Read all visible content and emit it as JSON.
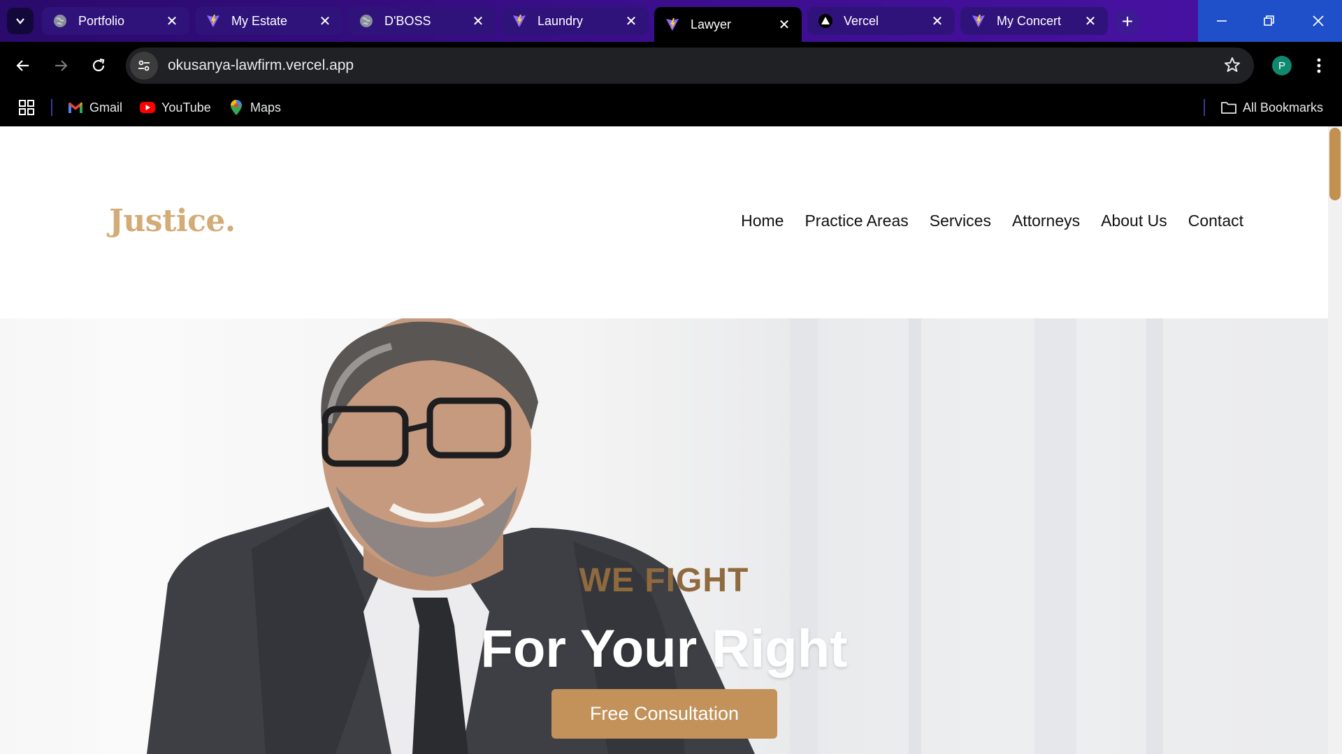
{
  "browser": {
    "tabs": [
      {
        "title": "Portfolio",
        "icon": "globe-icon"
      },
      {
        "title": "My Estate",
        "icon": "vite-icon"
      },
      {
        "title": "D'BOSS",
        "icon": "globe-icon"
      },
      {
        "title": "Laundry",
        "icon": "vite-icon"
      },
      {
        "title": "Lawyer",
        "icon": "vite-icon",
        "active": true
      },
      {
        "title": "Vercel",
        "icon": "vercel-icon"
      },
      {
        "title": "My Concert",
        "icon": "vite-icon"
      }
    ],
    "url": "okusanya-lawfirm.vercel.app",
    "profile_initial": "P",
    "bookmarks": [
      {
        "label": "Gmail",
        "icon": "gmail-icon"
      },
      {
        "label": "YouTube",
        "icon": "youtube-icon"
      },
      {
        "label": "Maps",
        "icon": "maps-icon"
      }
    ],
    "all_bookmarks_label": "All Bookmarks",
    "colors": {
      "accent_gold": "#c2925a",
      "logo_gold": "#d3ab76",
      "tabstrip": "#3a0e8a"
    }
  },
  "site": {
    "logo": "Justice.",
    "nav": [
      "Home",
      "Practice Areas",
      "Services",
      "Attorneys",
      "About Us",
      "Contact"
    ],
    "hero": {
      "kicker": "WE FIGHT",
      "headline": "For Your Right",
      "cta": "Free Consultation"
    }
  }
}
